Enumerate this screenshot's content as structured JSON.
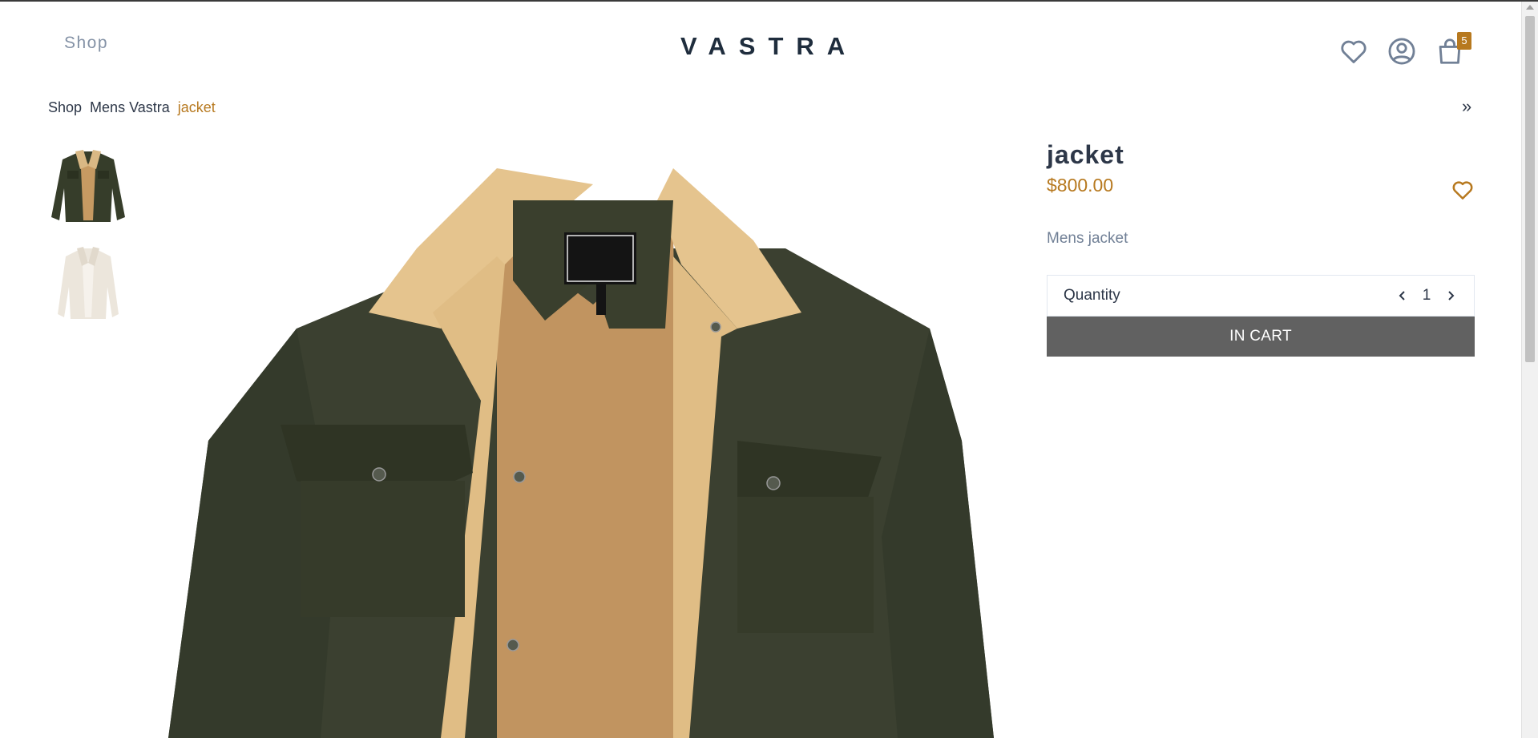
{
  "header": {
    "nav_shop": "Shop",
    "logo": "VASTRA",
    "icons": [
      "heart-icon",
      "user-circle-icon",
      "shopping-bag-icon"
    ],
    "cart_count": "5"
  },
  "breadcrumb": {
    "items": [
      "Shop",
      "Mens Vastra"
    ],
    "current": "jacket",
    "next_glyph": "»"
  },
  "gallery": {
    "thumbnails": [
      "olive jacket with sherpa collar",
      "cream sherpa jacket"
    ],
    "main_image": "olive jacket with sherpa collar"
  },
  "product": {
    "title": "jacket",
    "price": "$800.00",
    "description": "Mens jacket",
    "quantity_label": "Quantity",
    "quantity": "1",
    "cart_button": "IN CART"
  },
  "colors": {
    "accent": "#b7791f",
    "button": "#616161",
    "muted": "#718096"
  }
}
